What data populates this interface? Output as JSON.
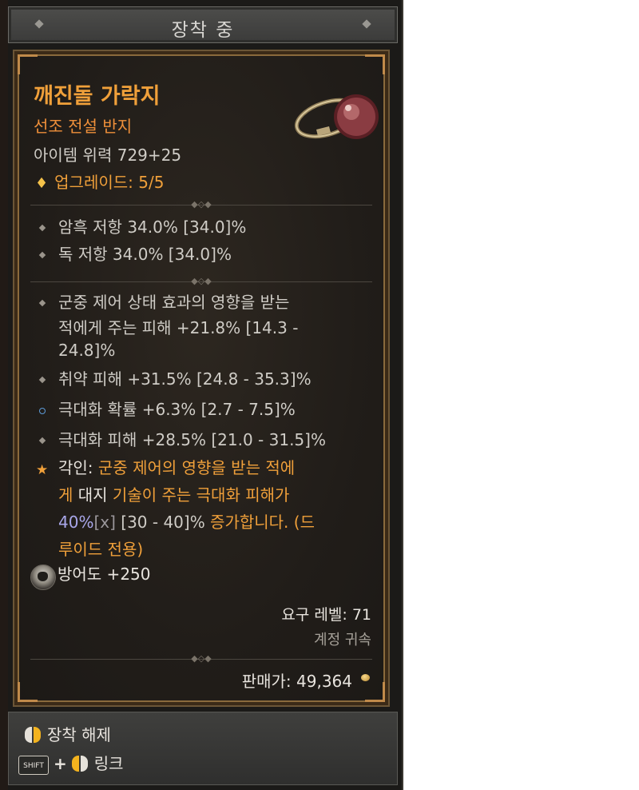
{
  "header": {
    "title": "장착 중"
  },
  "item": {
    "name": "깨진돌 가락지",
    "type": "선조 전설 반지",
    "power": "아이템 위력 729+25",
    "upgrade_icon": "diamond-icon",
    "upgrade": "업그레이드: 5/5"
  },
  "resistances": [
    {
      "text": "암흑 저항 34.0% [34.0]%"
    },
    {
      "text": "독 저항 34.0% [34.0]%"
    }
  ],
  "affixes": [
    {
      "line1": "군중 제어 상태 효과의 영향을 받는",
      "line2": "적에게 주는 피해 +21.8% [14.3 -",
      "line3": "24.8]%"
    },
    {
      "text": "취약 피해 +31.5% [24.8 - 35.3]%"
    },
    {
      "text": "극대화 확률 +6.3% [2.7 - 7.5]%"
    },
    {
      "text": "극대화 피해 +28.5% [21.0 - 31.5]%"
    }
  ],
  "aspect": {
    "label": "각인: ",
    "l1a": "군중 제어의 영향을 받는 적에",
    "l2a": "게 ",
    "l2b": "대지",
    "l2c": " 기술이 주는 극대화 피해가",
    "l3a": "40%",
    "l3b": "[x]",
    "l3c": " [30 - 40]%",
    "l3d": " 증가합니다. (드",
    "l4": "루이드 전용)"
  },
  "armor": {
    "text": "방어도 +250"
  },
  "requirements": {
    "level": "요구 레벨: 71",
    "bound": "계정 귀속"
  },
  "sell": {
    "text": "판매가: 49,364"
  },
  "footer": {
    "unequip_label": "장착 해제",
    "shift_key": "SHIFT",
    "link_label": "링크"
  },
  "colors": {
    "legendary": "#f0a03a",
    "stat": "#cfccc6",
    "magic_value": "#a9a7ea"
  }
}
